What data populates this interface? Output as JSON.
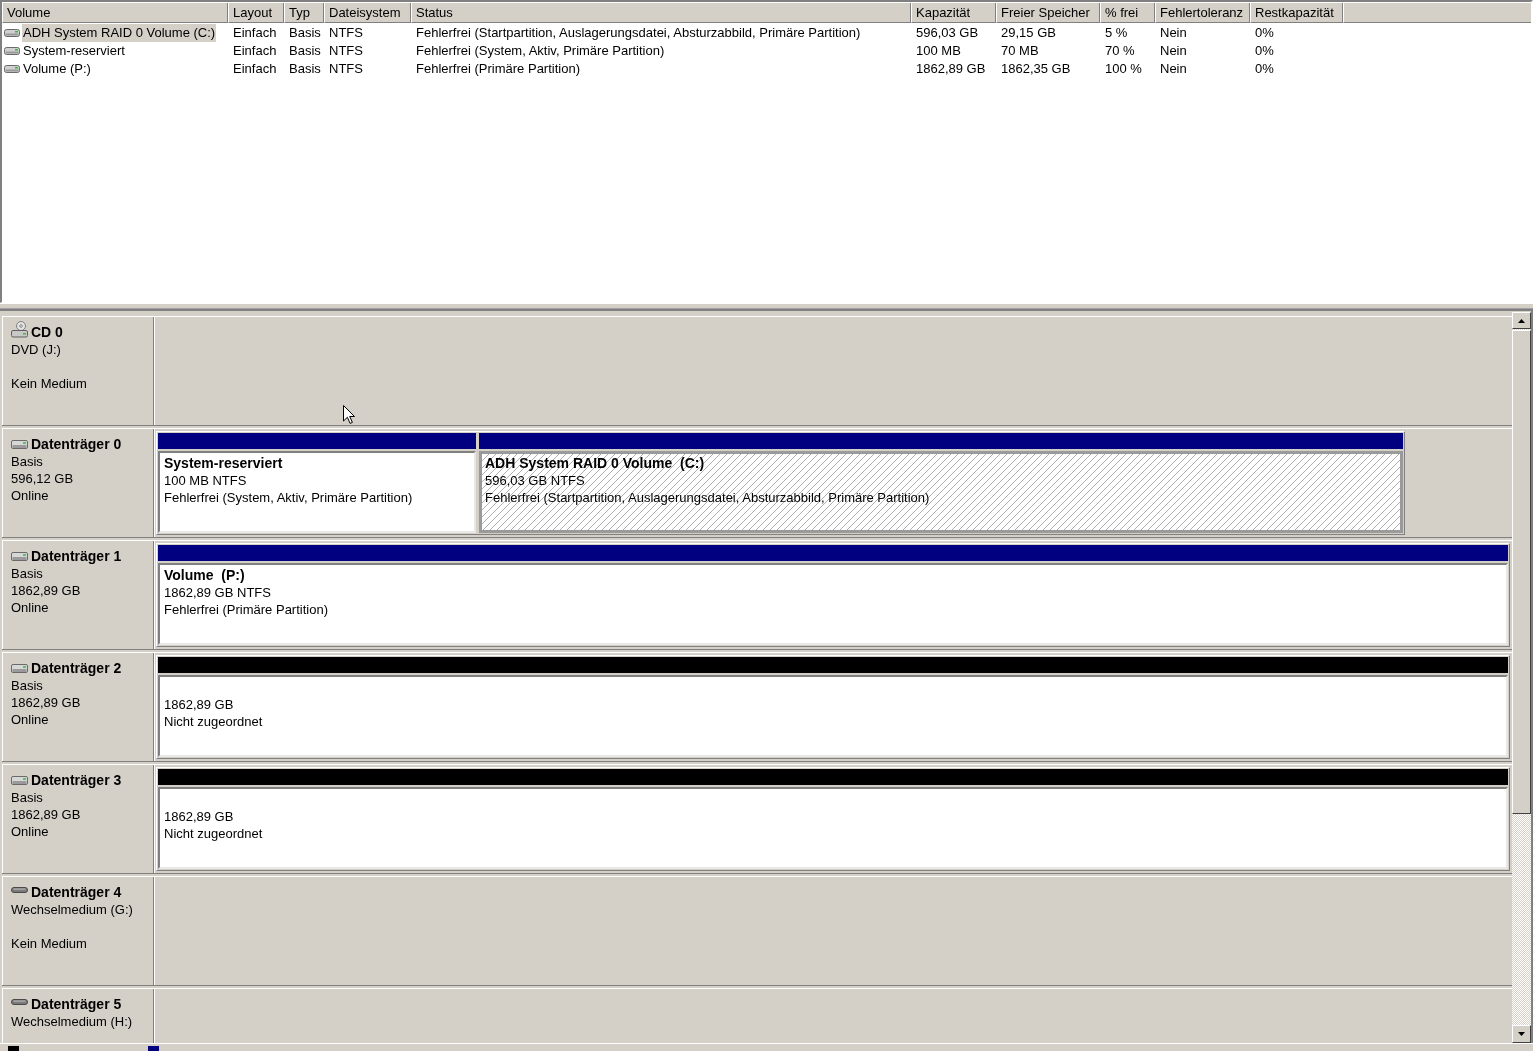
{
  "volume_list": {
    "columns": [
      "Volume",
      "Layout",
      "Typ",
      "Dateisystem",
      "Status",
      "Kapazität",
      "Freier Speicher",
      "% frei",
      "Fehlertoleranz",
      "Restkapazität"
    ],
    "rows": [
      {
        "selected": true,
        "cells": [
          "ADH System RAID 0 Volume (C:)",
          "Einfach",
          "Basis",
          "NTFS",
          "Fehlerfrei (Startpartition, Auslagerungsdatei, Absturzabbild, Primäre Partition)",
          "596,03 GB",
          "29,15 GB",
          "5 %",
          "Nein",
          "0%"
        ]
      },
      {
        "selected": false,
        "cells": [
          "System-reserviert",
          "Einfach",
          "Basis",
          "NTFS",
          "Fehlerfrei (System, Aktiv, Primäre Partition)",
          "100 MB",
          "70 MB",
          "70 %",
          "Nein",
          "0%"
        ]
      },
      {
        "selected": false,
        "cells": [
          "Volume (P:)",
          "Einfach",
          "Basis",
          "NTFS",
          "Fehlerfrei (Primäre Partition)",
          "1862,89 GB",
          "1862,35 GB",
          "100 %",
          "Nein",
          "0%"
        ]
      }
    ]
  },
  "disks": [
    {
      "kind": "cd",
      "name": "CD 0",
      "type": "DVD (J:)",
      "status": "Kein Medium"
    },
    {
      "kind": "disk",
      "name": "Datenträger 0",
      "type": "Basis",
      "size": "596,12 GB",
      "status": "Online",
      "partitions": [
        {
          "kind": "primary",
          "selected": false,
          "name": "System-reserviert",
          "size": "100 MB NTFS",
          "status": "Fehlerfrei (System, Aktiv, Primäre Partition)"
        },
        {
          "kind": "primary",
          "selected": true,
          "name": "ADH System RAID 0 Volume  (C:)",
          "size": "596,03 GB NTFS",
          "status": "Fehlerfrei (Startpartition, Auslagerungsdatei, Absturzabbild, Primäre Partition)"
        }
      ]
    },
    {
      "kind": "disk",
      "name": "Datenträger 1",
      "type": "Basis",
      "size": "1862,89 GB",
      "status": "Online",
      "partitions": [
        {
          "kind": "primary",
          "selected": false,
          "name": "Volume  (P:)",
          "size": "1862,89 GB NTFS",
          "status": "Fehlerfrei (Primäre Partition)"
        }
      ]
    },
    {
      "kind": "disk",
      "name": "Datenträger 2",
      "type": "Basis",
      "size": "1862,89 GB",
      "status": "Online",
      "partitions": [
        {
          "kind": "unallocated",
          "selected": false,
          "size": "1862,89 GB",
          "status": "Nicht zugeordnet"
        }
      ]
    },
    {
      "kind": "disk",
      "name": "Datenträger 3",
      "type": "Basis",
      "size": "1862,89 GB",
      "status": "Online",
      "partitions": [
        {
          "kind": "unallocated",
          "selected": false,
          "size": "1862,89 GB",
          "status": "Nicht zugeordnet"
        }
      ]
    },
    {
      "kind": "removable",
      "name": "Datenträger 4",
      "type": "Wechselmedium (G:)",
      "status": "Kein Medium"
    },
    {
      "kind": "removable",
      "name": "Datenträger 5",
      "type": "Wechselmedium (H:)"
    }
  ],
  "legend": [
    {
      "color": "#000000"
    },
    {
      "color": "#000080"
    }
  ]
}
